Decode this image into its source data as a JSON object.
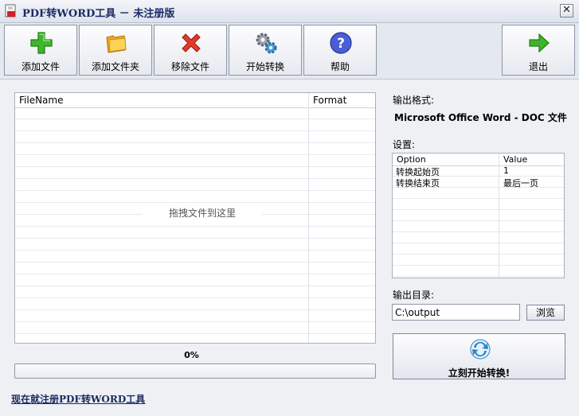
{
  "window": {
    "title": "PDF转WORD工具 － 未注册版",
    "close_glyph": "✕"
  },
  "toolbar": {
    "add_file": "添加文件",
    "add_folder": "添加文件夹",
    "remove_file": "移除文件",
    "start_convert": "开始转换",
    "help": "帮助",
    "exit": "退出"
  },
  "files": {
    "columns": [
      "FileName",
      "Format"
    ],
    "drop_hint": "拖拽文件到这里"
  },
  "progress": {
    "percent_text": "0%",
    "value": 0
  },
  "register_link": "现在就注册PDF转WORD工具",
  "output": {
    "format_label": "输出格式:",
    "format_value": "Microsoft Office Word - DOC 文件",
    "settings_label": "设置:",
    "settings_columns": [
      "Option",
      "Value"
    ],
    "settings_rows": [
      {
        "option": "转换起始页",
        "value": "1"
      },
      {
        "option": "转换结束页",
        "value": "最后一页"
      }
    ],
    "dir_label": "输出目录:",
    "dir_value": "C:\\output",
    "browse_label": "浏览",
    "start_label": "立刻开始转换!"
  },
  "icons": {
    "add": "plus-icon",
    "folder": "folder-icon",
    "remove": "x-icon",
    "convert": "gears-icon",
    "help": "question-icon",
    "exit": "arrow-right-icon",
    "start": "convert-arrows-icon"
  }
}
